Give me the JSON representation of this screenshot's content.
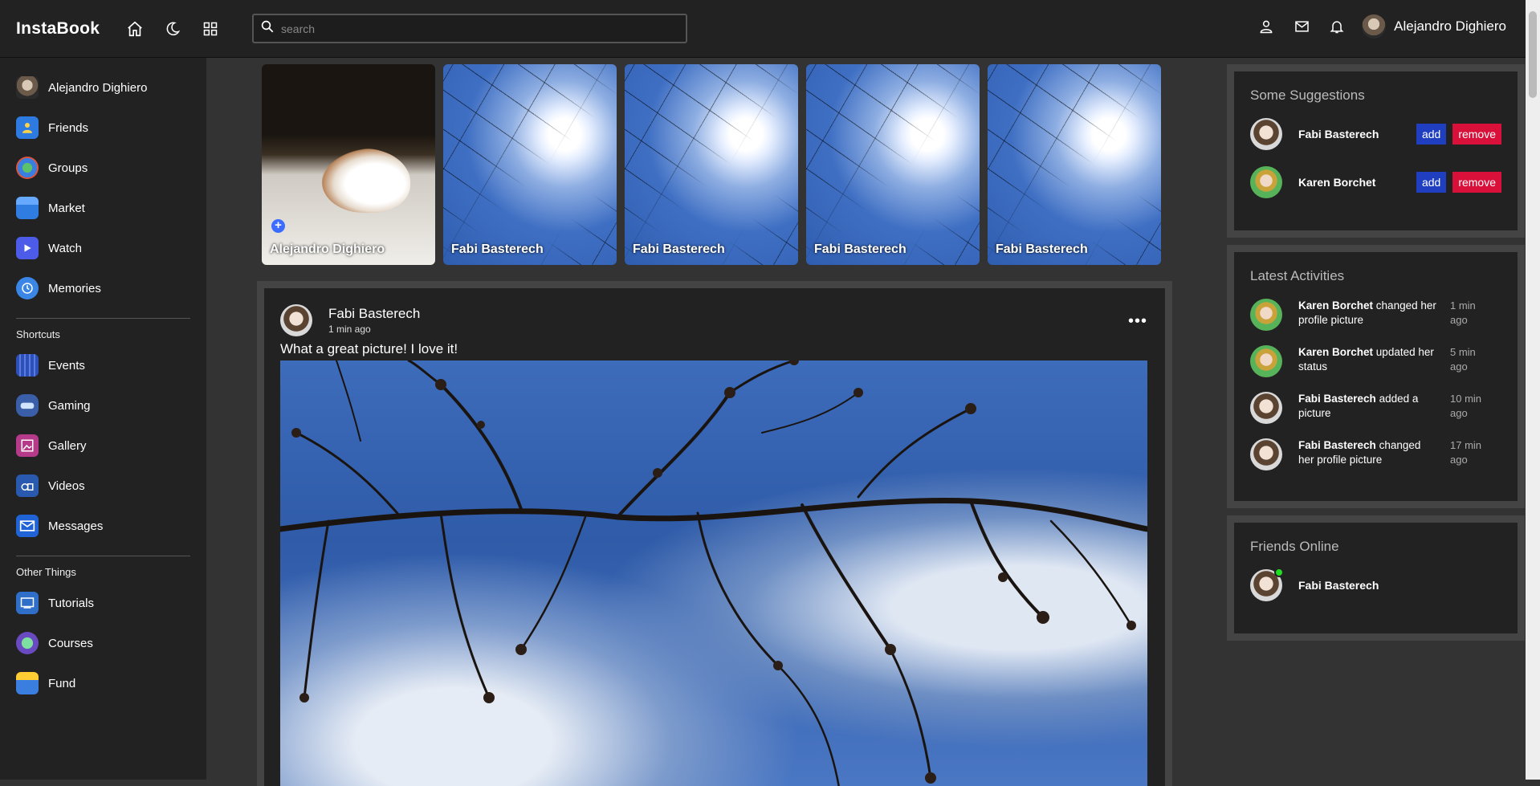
{
  "app": {
    "name": "InstaBook"
  },
  "header": {
    "search_placeholder": "search",
    "user_name": "Alejandro Dighiero",
    "icons": [
      "home-icon",
      "dark-mode-icon",
      "apps-grid-icon",
      "person-icon",
      "mail-icon",
      "bell-icon"
    ]
  },
  "sidebar": {
    "top_items": [
      {
        "label": "Alejandro Dighiero",
        "icon": "avatar"
      },
      {
        "label": "Friends",
        "icon": "friends-icon"
      },
      {
        "label": "Groups",
        "icon": "groups-icon"
      },
      {
        "label": "Market",
        "icon": "market-icon"
      },
      {
        "label": "Watch",
        "icon": "watch-icon"
      },
      {
        "label": "Memories",
        "icon": "memories-icon"
      }
    ],
    "shortcuts_heading": "Shortcuts",
    "shortcuts": [
      {
        "label": "Events",
        "icon": "events-icon"
      },
      {
        "label": "Gaming",
        "icon": "gaming-icon"
      },
      {
        "label": "Gallery",
        "icon": "gallery-icon"
      },
      {
        "label": "Videos",
        "icon": "videos-icon"
      },
      {
        "label": "Messages",
        "icon": "messages-icon"
      }
    ],
    "other_heading": "Other Things",
    "other": [
      {
        "label": "Tutorials",
        "icon": "tutorials-icon"
      },
      {
        "label": "Courses",
        "icon": "courses-icon"
      },
      {
        "label": "Fund",
        "icon": "fund-icon"
      }
    ]
  },
  "stories": [
    {
      "name": "Alejandro Dighiero",
      "type": "own"
    },
    {
      "name": "Fabi Basterech",
      "type": "friend"
    },
    {
      "name": "Fabi Basterech",
      "type": "friend"
    },
    {
      "name": "Fabi Basterech",
      "type": "friend"
    },
    {
      "name": "Fabi Basterech",
      "type": "friend"
    }
  ],
  "post": {
    "author": "Fabi Basterech",
    "time": "1 min ago",
    "text": "What a great picture! I love it!",
    "menu_icon": "more-dots-icon"
  },
  "suggestions": {
    "title": "Some Suggestions",
    "people": [
      {
        "name": "Fabi Basterech",
        "add_label": "add",
        "remove_label": "remove"
      },
      {
        "name": "Karen Borchet",
        "add_label": "add",
        "remove_label": "remove"
      }
    ]
  },
  "activities": {
    "title": "Latest Activities",
    "items": [
      {
        "name": "Karen Borchet",
        "action": "changed her profile picture",
        "time": "1 min ago"
      },
      {
        "name": "Karen Borchet",
        "action": "updated her status",
        "time": "5 min ago"
      },
      {
        "name": "Fabi Basterech",
        "action": "added a picture",
        "time": "10 min ago"
      },
      {
        "name": "Fabi Basterech",
        "action": "changed her profile picture",
        "time": "17 min ago"
      }
    ]
  },
  "friends_online": {
    "title": "Friends Online",
    "people": [
      {
        "name": "Fabi Basterech"
      }
    ]
  }
}
